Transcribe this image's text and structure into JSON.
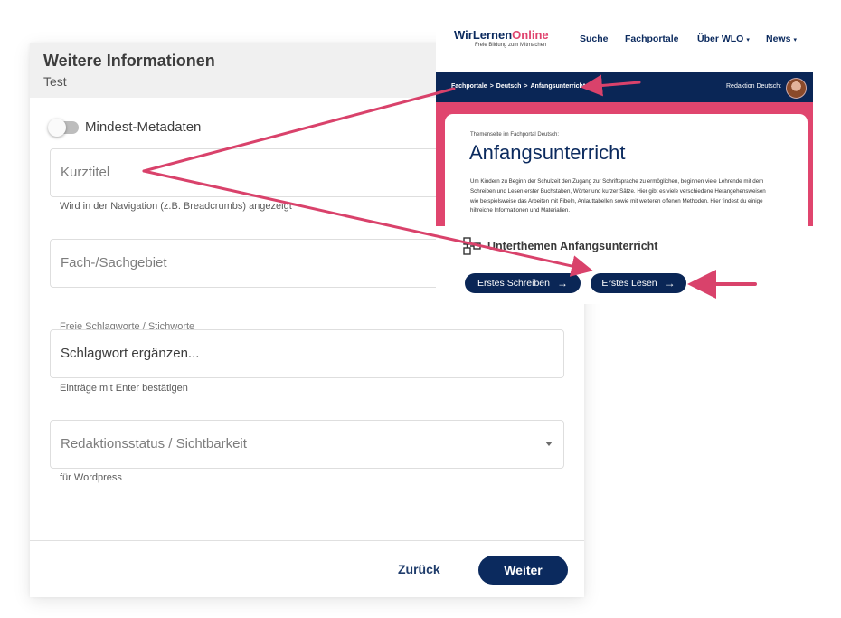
{
  "dialog": {
    "title": "Weitere Informationen",
    "subtitle": "Test",
    "toggle_label": "Mindest-Metadaten",
    "toggle_on": false,
    "fields": {
      "kurztitel_placeholder": "Kurztitel",
      "kurztitel_hint": "Wird in der Navigation (z.B. Breadcrumbs) angezeigt",
      "fach_placeholder": "Fach-/Sachgebiet",
      "keywords_label": "Freie Schlagworte / Stichworte",
      "keywords_value": "Schlagwort ergänzen...",
      "keywords_hint": "Einträge mit Enter bestätigen",
      "status_placeholder": "Redaktionsstatus / Sichtbarkeit",
      "status_hint": "für Wordpress"
    },
    "footer": {
      "back_label": "Zurück",
      "next_label": "Weiter"
    }
  },
  "web": {
    "logo": {
      "part1": "WirLernen",
      "part2": "Online",
      "tagline": "Freie Bildung zum Mitmachen"
    },
    "nav": [
      "Suche",
      "Fachportale",
      "Über WLO",
      "News"
    ],
    "breadcrumb": [
      "Fachportale",
      "Deutsch",
      "Anfangsunterricht"
    ],
    "redaktion_label": "Redaktion Deutsch:",
    "kicker": "Themenseite im Fachportal Deutsch:",
    "heading": "Anfangsunterricht",
    "paragraph": "Um Kindern zu Beginn der Schulzeit den Zugang zur Schriftsprache zu ermöglichen, beginnen viele Lehrende mit dem Schreiben und Lesen erster Buchstaben, Wörter und kurzer Sätze. Hier gibt es viele verschiedene Herangehensweisen wie beispielsweise das Arbeiten mit Fibeln, Anlauttabellen sowie mit weiteren offenen Methoden. Hier findest du einige hilfreiche Informationen und Materialien.",
    "subtopics_title": "Unterthemen Anfangsunterricht",
    "subtopic_buttons": [
      "Erstes Schreiben",
      "Erstes Lesen"
    ],
    "colors": {
      "navy": "#0a2656",
      "pink": "#e0456e"
    }
  },
  "annotation_color": "#d9426b"
}
